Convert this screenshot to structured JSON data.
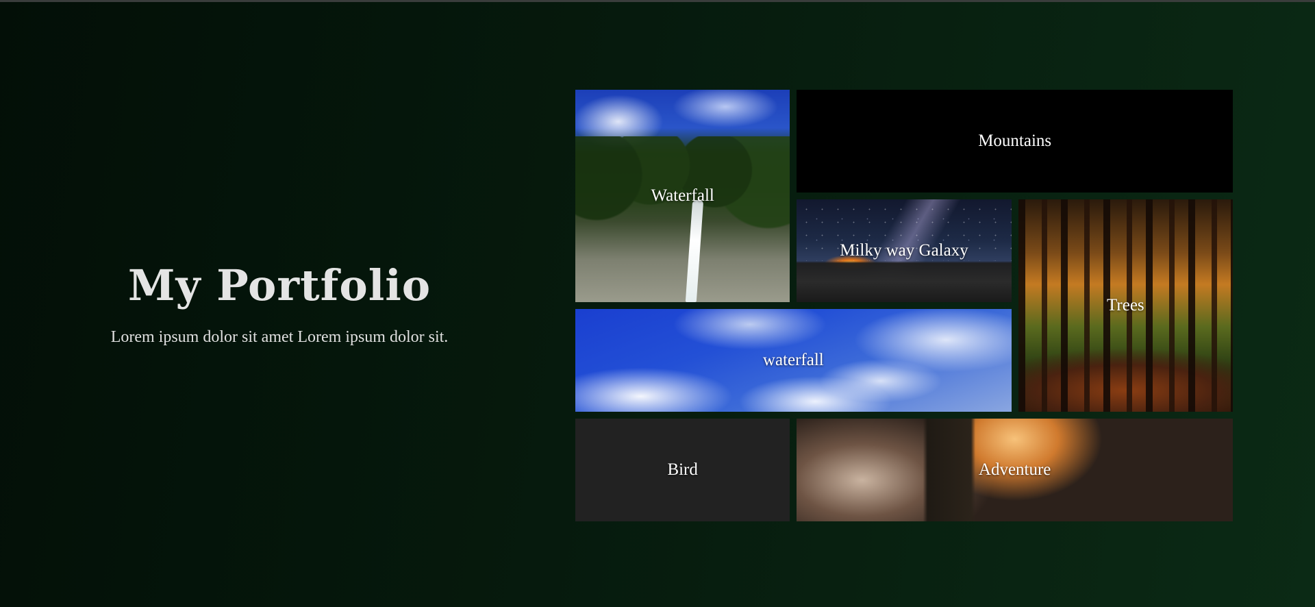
{
  "hero": {
    "title": "My Portfolio",
    "subtitle": "Lorem ipsum dolor sit amet Lorem ipsum dolor sit."
  },
  "gallery": {
    "tiles": [
      {
        "label": "Waterfall"
      },
      {
        "label": "Mountains"
      },
      {
        "label": "Milky way Galaxy"
      },
      {
        "label": "Trees"
      },
      {
        "label": "waterfall"
      },
      {
        "label": "Bird"
      },
      {
        "label": "Adventure"
      }
    ]
  },
  "colors": {
    "background_start": "#030f07",
    "background_end": "#0b2a15",
    "text": "#e4e4e4",
    "mountains_tile": "#000000",
    "bird_tile": "#222222"
  }
}
